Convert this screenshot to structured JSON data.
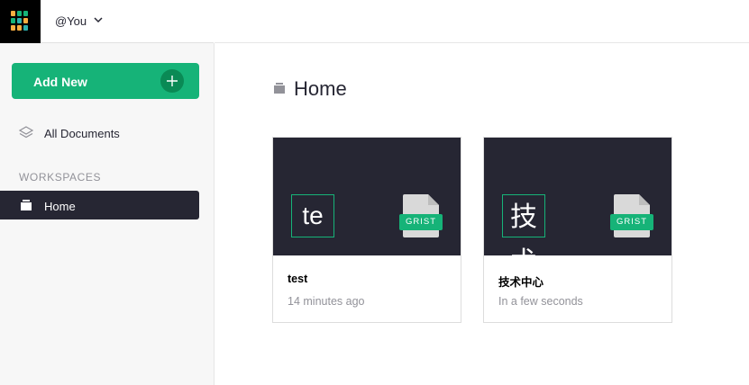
{
  "org": {
    "name": "@You"
  },
  "sidebar": {
    "add_new_label": "Add New",
    "all_documents_label": "All Documents",
    "workspaces_heading": "WORKSPACES",
    "workspaces": [
      {
        "label": "Home"
      }
    ]
  },
  "main": {
    "title": "Home",
    "docs": [
      {
        "initials": "te",
        "badge": "GRIST",
        "name": "test",
        "time": "14 minutes ago"
      },
      {
        "initials": "技术",
        "badge": "GRIST",
        "name": "技术中心",
        "time": "In a few seconds"
      }
    ]
  },
  "colors": {
    "accent": "#16b378",
    "dark": "#262633",
    "muted": "#929299"
  },
  "icons": [
    "grist-logo-icon",
    "chevron-down-icon",
    "plus-icon",
    "layers-icon",
    "folder-icon",
    "file-icon"
  ]
}
